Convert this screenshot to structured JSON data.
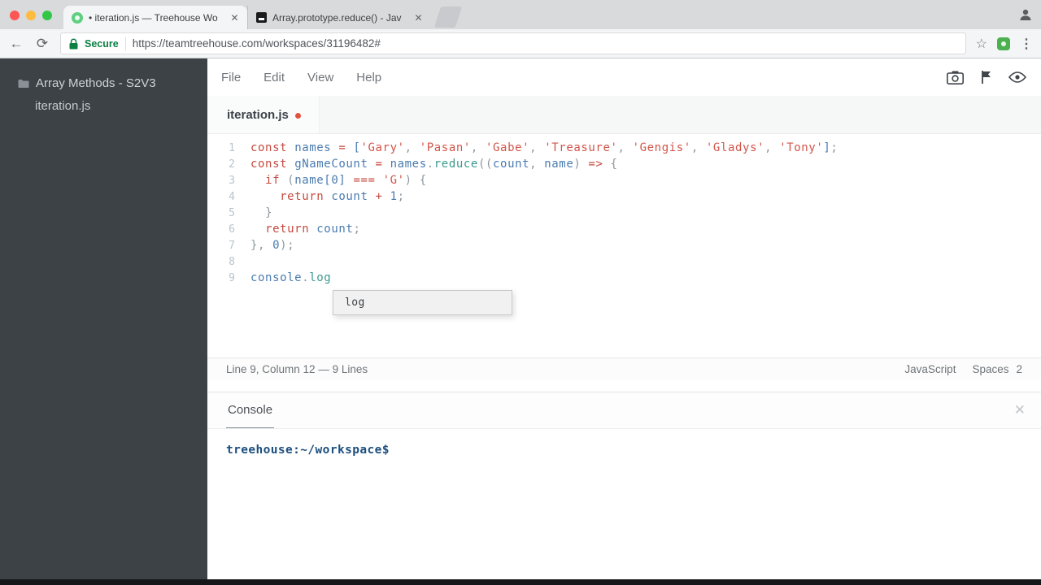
{
  "browser": {
    "tabs": [
      {
        "title": "• iteration.js — Treehouse Wo",
        "icon": "treehouse-favicon"
      },
      {
        "title": "Array.prototype.reduce() - Jav",
        "icon": "mdn-favicon"
      }
    ],
    "secure_label": "Secure",
    "url": "https://teamtreehouse.com/workspaces/31196482#"
  },
  "sidebar": {
    "project": "Array Methods - S2V3",
    "file": "iteration.js"
  },
  "menubar": {
    "items": [
      "File",
      "Edit",
      "View",
      "Help"
    ]
  },
  "editor_tab": {
    "label": "iteration.js"
  },
  "editor": {
    "lines": [
      {
        "n": "1",
        "tokens": [
          [
            "k",
            "const "
          ],
          [
            "v",
            "names"
          ],
          [
            "d",
            " "
          ],
          [
            "k",
            "="
          ],
          [
            "d",
            " "
          ],
          [
            "v",
            "["
          ],
          [
            "s",
            "'Gary'"
          ],
          [
            "p",
            ", "
          ],
          [
            "s",
            "'Pasan'"
          ],
          [
            "p",
            ", "
          ],
          [
            "s",
            "'Gabe'"
          ],
          [
            "p",
            ", "
          ],
          [
            "s",
            "'Treasure'"
          ],
          [
            "p",
            ", "
          ],
          [
            "s",
            "'Gengis'"
          ],
          [
            "p",
            ", "
          ],
          [
            "s",
            "'Gladys'"
          ],
          [
            "p",
            ", "
          ],
          [
            "s",
            "'Tony'"
          ],
          [
            "v",
            "]"
          ],
          [
            "p",
            ";"
          ]
        ]
      },
      {
        "n": "2",
        "tokens": [
          [
            "k",
            "const "
          ],
          [
            "v",
            "gNameCount"
          ],
          [
            "d",
            " "
          ],
          [
            "k",
            "="
          ],
          [
            "d",
            " "
          ],
          [
            "v",
            "names"
          ],
          [
            "p",
            "."
          ],
          [
            "f",
            "reduce"
          ],
          [
            "p",
            "(("
          ],
          [
            "v",
            "count"
          ],
          [
            "p",
            ", "
          ],
          [
            "v",
            "name"
          ],
          [
            "p",
            ") "
          ],
          [
            "k",
            "=>"
          ],
          [
            "p",
            " {"
          ]
        ]
      },
      {
        "n": "3",
        "tokens": [
          [
            "d",
            "  "
          ],
          [
            "k",
            "if"
          ],
          [
            "p",
            " ("
          ],
          [
            "v",
            "name["
          ],
          [
            "n",
            "0"
          ],
          [
            "v",
            "]"
          ],
          [
            "d",
            " "
          ],
          [
            "k",
            "==="
          ],
          [
            "d",
            " "
          ],
          [
            "s",
            "'G'"
          ],
          [
            "p",
            ") {"
          ]
        ]
      },
      {
        "n": "4",
        "tokens": [
          [
            "d",
            "    "
          ],
          [
            "k",
            "return"
          ],
          [
            "d",
            " "
          ],
          [
            "v",
            "count"
          ],
          [
            "d",
            " "
          ],
          [
            "k",
            "+"
          ],
          [
            "d",
            " "
          ],
          [
            "n",
            "1"
          ],
          [
            "p",
            ";"
          ]
        ]
      },
      {
        "n": "5",
        "tokens": [
          [
            "d",
            "  "
          ],
          [
            "p",
            "}"
          ]
        ]
      },
      {
        "n": "6",
        "tokens": [
          [
            "d",
            "  "
          ],
          [
            "k",
            "return"
          ],
          [
            "d",
            " "
          ],
          [
            "v",
            "count"
          ],
          [
            "p",
            ";"
          ]
        ]
      },
      {
        "n": "7",
        "tokens": [
          [
            "p",
            "}, "
          ],
          [
            "n",
            "0"
          ],
          [
            "p",
            ");"
          ]
        ]
      },
      {
        "n": "8",
        "tokens": []
      },
      {
        "n": "9",
        "tokens": [
          [
            "v",
            "console"
          ],
          [
            "p",
            "."
          ],
          [
            "f",
            "log"
          ]
        ]
      }
    ],
    "autocomplete": {
      "items": [
        "log"
      ]
    }
  },
  "statusbar": {
    "left": "Line 9, Column 12 — 9 Lines",
    "language": "JavaScript",
    "spaces_label": "Spaces",
    "indent": "2"
  },
  "console_panel": {
    "title": "Console",
    "prompt": "treehouse:~/workspace$",
    "close_glyph": "✕"
  },
  "glyphs": {
    "back": "←",
    "reload": "⟳",
    "star": "☆",
    "kebab": "⋮",
    "tab_close": "✕"
  },
  "colors": {
    "dirty_dot": "#e0543e",
    "secure_green": "#0b8043",
    "prompt_blue": "#1b4e7e",
    "sidebar_bg": "#3d4247"
  }
}
